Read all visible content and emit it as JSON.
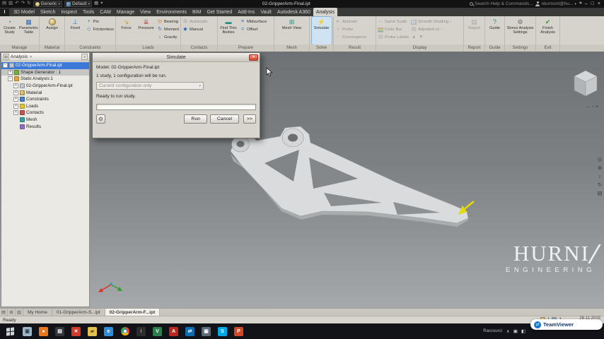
{
  "titlebar": {
    "material_dropdown": {
      "label": "Generic"
    },
    "appearance_dropdown": {
      "label": "Default"
    },
    "document_title": "02-GripperArm-Final.ipt",
    "search_placeholder": "Search Help & Commands...",
    "account_label": "nturmont@hu..."
  },
  "ribbon_tabs": [
    {
      "label": "3D Model"
    },
    {
      "label": "Sketch"
    },
    {
      "label": "Inspect"
    },
    {
      "label": "Tools"
    },
    {
      "label": "CAM"
    },
    {
      "label": "Manage"
    },
    {
      "label": "View"
    },
    {
      "label": "Environments"
    },
    {
      "label": "BIM"
    },
    {
      "label": "Get Started"
    },
    {
      "label": "Add-Ins"
    },
    {
      "label": "Vault"
    },
    {
      "label": "Autodesk A360"
    },
    {
      "label": "Analysis"
    }
  ],
  "ribbon": {
    "manage": {
      "label": "Manage",
      "create_study": "Create Study",
      "parametric_table": "Parametric Table"
    },
    "material": {
      "label": "Material",
      "assign": "Assign"
    },
    "constraints": {
      "label": "Constraints",
      "fixed": "Fixed",
      "pin": "Pin",
      "frictionless": "Frictionless"
    },
    "loads": {
      "label": "Loads",
      "force": "Force",
      "pressure": "Pressure",
      "bearing": "Bearing",
      "moment": "Moment",
      "gravity": "Gravity"
    },
    "contacts": {
      "label": "Contacts",
      "automatic": "Automatic",
      "manual": "Manual"
    },
    "prepare": {
      "label": "Prepare",
      "find_thin_bodies": "Find Thin Bodies",
      "midsurface": "Midsurface",
      "offset": "Offset"
    },
    "mesh": {
      "label": "Mesh",
      "mesh_view": "Mesh View"
    },
    "solve": {
      "label": "Solve",
      "simulate": "Simulate"
    },
    "result": {
      "label": "Result",
      "animate": "Animate",
      "probe": "Probe",
      "convergence": "Convergence"
    },
    "display": {
      "label": "Display",
      "same_scale": "Same Scale",
      "color_bar": "Color Bar",
      "probe_labels": "Probe Labels",
      "smooth_shading": "Smooth Shading",
      "adjusted": "Adjusted x1"
    },
    "report": {
      "label": "Report",
      "button": "Report"
    },
    "guide": {
      "label": "Guide",
      "button": "Guide"
    },
    "settings": {
      "label": "Settings",
      "button": "Stress Analysis Settings"
    },
    "exit": {
      "label": "Exit",
      "button": "Finish Analysis"
    }
  },
  "browser": {
    "header": "Analysis",
    "rows": [
      {
        "label": "02-GripperArm-Final.ipt"
      },
      {
        "label": "Shape Generator : 1"
      },
      {
        "label": "Static Analysis:1"
      },
      {
        "label": "02-GripperArm-Final.ipt"
      },
      {
        "label": "Material"
      },
      {
        "label": "Constraints"
      },
      {
        "label": "Loads"
      },
      {
        "label": "Contacts"
      },
      {
        "label": "Mesh"
      },
      {
        "label": "Results"
      }
    ]
  },
  "dialog": {
    "title": "Simulate",
    "model_line": "Model: 02-GripperArm-Final.ipt",
    "summary_line": "1 study,  1 configuration will be run.",
    "config_dropdown": "Current configuration only",
    "status_line": "Ready to run study.",
    "run": "Run",
    "cancel": "Cancel",
    "more": ">>"
  },
  "viewport": {
    "watermark_top": "HURNI",
    "watermark_bottom": "ENGINEERING"
  },
  "doc_tabs": [
    {
      "label": "My Home"
    },
    {
      "label": "01-GripperArm-S...ipt"
    },
    {
      "label": "02-GripperArm-F...ipt"
    }
  ],
  "statusbar": {
    "ready": "Ready",
    "count1": "1",
    "count2": "1",
    "date": "28.11.2015"
  },
  "taskbar": {
    "tray_label": "Raccourci",
    "teamviewer": "TeamViewer"
  },
  "colors": {
    "selection_blue": "#3b78d8",
    "force_arrow_yellow": "#e2da00",
    "close_red": "#cf4631",
    "viewport_gray": "#7d8184"
  }
}
